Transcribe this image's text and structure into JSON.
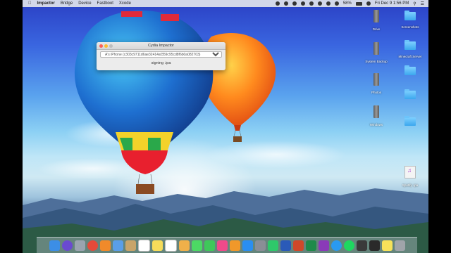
{
  "menubar": {
    "app_name": "Impactor",
    "menus": [
      "Bridge",
      "Device",
      "Fastboot",
      "Xcode"
    ],
    "battery": "58%",
    "clock": "Fri Dec 9  1:56 PM"
  },
  "window": {
    "title": "Cydia Impactor",
    "device_select": "A's iPhone (c303c9711d6ae32414af359c95cd8f6b0a082703)",
    "status": "signing .ipa"
  },
  "desktop_icons": {
    "drive": "Drive",
    "screenshots": "Screenshots",
    "system_backup": "System Backup",
    "minecraft_server": "Minecraft Server",
    "photos": "Photos",
    "windows": "Windows",
    "spotify_ipa": "Spotify .ipa"
  },
  "dock": {
    "icons": [
      "finder-icon",
      "siri-icon",
      "launchpad-icon",
      "chrome-icon",
      "firefox-icon",
      "mail-icon",
      "contacts-icon",
      "calendar-icon",
      "notes-icon",
      "reminders-icon",
      "photos-icon",
      "messages-icon",
      "facetime-icon",
      "itunes-icon",
      "ibooks-icon",
      "appstore-icon",
      "preferences-icon",
      "evernote-icon",
      "word-icon",
      "powerpoint-icon",
      "excel-icon",
      "onenote-icon",
      "safari-icon",
      "spotify-icon",
      "iphone-icon",
      "terminal-icon",
      "stickies-icon",
      "trash-icon"
    ],
    "colors": [
      "#3c8ee6",
      "#6a4ad0",
      "#9aa4b0",
      "#e64a3a",
      "#f08a2a",
      "#5a9ee8",
      "#c8a46a",
      "#ffffff",
      "#f6dc5a",
      "#ffffff",
      "#f0b04a",
      "#4cd964",
      "#3fc85a",
      "#f04a8a",
      "#f0982a",
      "#2a8ef0",
      "#8a8e96",
      "#2ec86a",
      "#2a5ab8",
      "#d0482a",
      "#1e8a4a",
      "#8a3ab8",
      "#2a9af0",
      "#1ed760",
      "#3a3a3a",
      "#2a2a2a",
      "#f6e25a",
      "#a0a4aa"
    ]
  }
}
